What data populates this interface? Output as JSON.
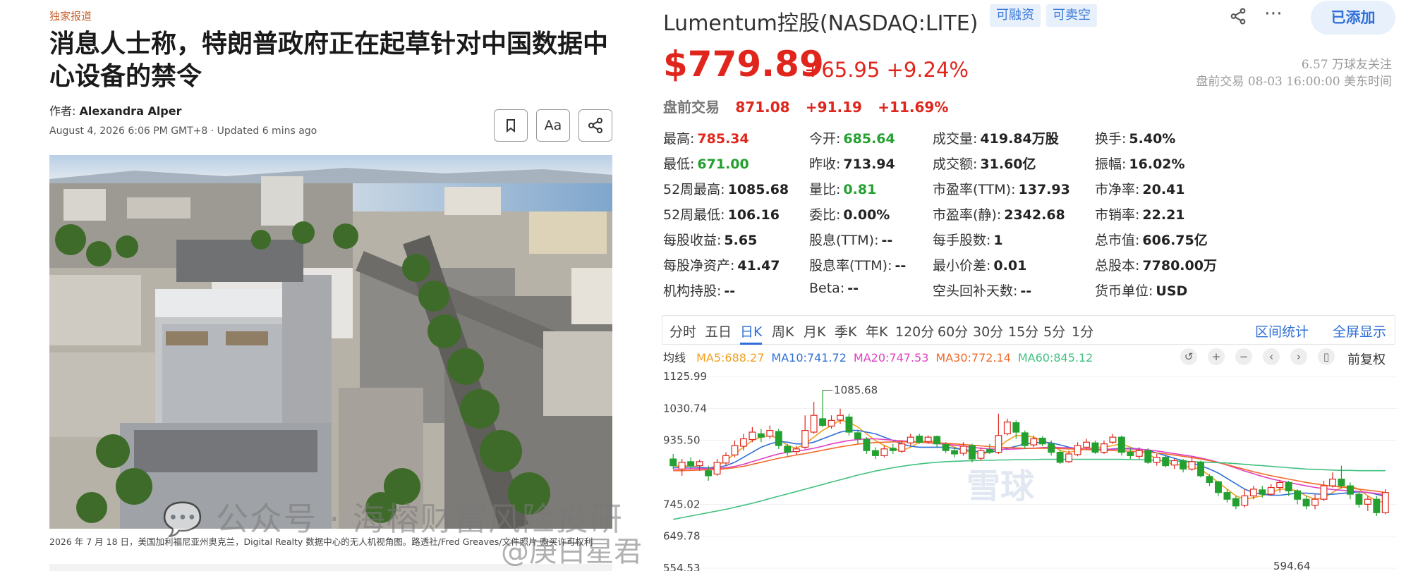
{
  "article": {
    "tag": "独家报道",
    "headline": "消息人士称，特朗普政府正在起草针对中国数据中心设备的禁令",
    "author_label": "作者:",
    "author_name": "Alexandra Alper",
    "dateline": "August 4, 2026 6:06 PM GMT+8 · Updated 6 mins ago",
    "bookmark_icon": "bookmark-icon",
    "font_size_label": "Aa",
    "share_icon": "share-icon",
    "photo_alt": "Digital Realty 数据中心的无人机视角图",
    "caption": "2026 年 7 月 18 日，美国加利福尼亚州奥克兰，Digital Realty 数据中心的无人机视角图。路透社/Fred Greaves/文件照片 购买许可权利"
  },
  "stock": {
    "title": "Lumentum控股(NASDAQ:LITE)",
    "pill_margin": "可融资",
    "pill_short": "可卖空",
    "share_icon": "share-icon",
    "more_icon": "more-icon",
    "follow_label": "已添加",
    "price": "$779.89",
    "change": "+65.95 +9.24%",
    "followers": "6.57 万球友关注",
    "status": "盘前交易 08-03 16:00:00 美东时间",
    "pre_label": "盘前交易",
    "pre_price": "871.08",
    "pre_change": "+91.19",
    "pre_pct": "+11.69%",
    "quote": [
      [
        {
          "k": "最高:",
          "v": "785.34",
          "c": "red"
        },
        {
          "k": "今开:",
          "v": "685.64",
          "c": "green"
        },
        {
          "k": "成交量:",
          "v": "419.84万股",
          "c": ""
        },
        {
          "k": "换手:",
          "v": "5.40%",
          "c": ""
        }
      ],
      [
        {
          "k": "最低:",
          "v": "671.00",
          "c": "green"
        },
        {
          "k": "昨收:",
          "v": "713.94",
          "c": ""
        },
        {
          "k": "成交额:",
          "v": "31.60亿",
          "c": ""
        },
        {
          "k": "振幅:",
          "v": "16.02%",
          "c": ""
        }
      ],
      [
        {
          "k": "52周最高:",
          "v": "1085.68",
          "c": ""
        },
        {
          "k": "量比:",
          "v": "0.81",
          "c": "green"
        },
        {
          "k": "市盈率(TTM):",
          "v": "137.93",
          "c": ""
        },
        {
          "k": "市净率:",
          "v": "20.41",
          "c": ""
        }
      ],
      [
        {
          "k": "52周最低:",
          "v": "106.16",
          "c": ""
        },
        {
          "k": "委比:",
          "v": "0.00%",
          "c": ""
        },
        {
          "k": "市盈率(静):",
          "v": "2342.68",
          "c": ""
        },
        {
          "k": "市销率:",
          "v": "22.21",
          "c": ""
        }
      ],
      [
        {
          "k": "每股收益:",
          "v": "5.65",
          "c": ""
        },
        {
          "k": "股息(TTM):",
          "v": "--",
          "c": ""
        },
        {
          "k": "每手股数:",
          "v": "1",
          "c": ""
        },
        {
          "k": "总市值:",
          "v": "606.75亿",
          "c": ""
        }
      ],
      [
        {
          "k": "每股净资产:",
          "v": "41.47",
          "c": ""
        },
        {
          "k": "股息率(TTM):",
          "v": "--",
          "c": ""
        },
        {
          "k": "最小价差:",
          "v": "0.01",
          "c": ""
        },
        {
          "k": "总股本:",
          "v": "7780.00万",
          "c": ""
        }
      ],
      [
        {
          "k": "机构持股:",
          "v": "--",
          "c": ""
        },
        {
          "k": "Beta:",
          "v": "--",
          "c": ""
        },
        {
          "k": "空头回补天数:",
          "v": "--",
          "c": ""
        },
        {
          "k": "货币单位:",
          "v": "USD",
          "c": ""
        }
      ]
    ],
    "tabs": [
      "分时",
      "五日",
      "日K",
      "周K",
      "月K",
      "季K",
      "年K",
      "120分",
      "60分",
      "30分",
      "15分",
      "5分",
      "1分"
    ],
    "active_tab": "日K",
    "tab_stats": "区间统计",
    "tab_full": "全屏显示",
    "ma_label": "均线",
    "ma": [
      {
        "label": "MA5:688.27",
        "color": "#f0a020"
      },
      {
        "label": "MA10:741.72",
        "color": "#2f6fd6"
      },
      {
        "label": "MA20:747.53",
        "color": "#e040c0"
      },
      {
        "label": "MA30:772.14",
        "color": "#f06a2a"
      },
      {
        "label": "MA60:845.12",
        "color": "#40c080"
      }
    ],
    "ctrl_icons": [
      "reset-icon",
      "zoom-in-icon",
      "zoom-out-icon",
      "prev-icon",
      "next-icon",
      "candle-toggle-icon"
    ],
    "adjust_label": "前复权"
  },
  "chart_data": {
    "type": "candlestick",
    "y_ticks": [
      "1125.99",
      "1030.74",
      "935.50",
      "745.02",
      "649.78",
      "554.53"
    ],
    "high_marker": "1085.68",
    "low_marker": "594.64",
    "ylim": [
      554.53,
      1125.99
    ],
    "up_color": "#e0261c",
    "down_color": "#23a030",
    "candles": [
      [
        880,
        860,
        895,
        850
      ],
      [
        850,
        870,
        880,
        830
      ],
      [
        872,
        860,
        885,
        852
      ],
      [
        860,
        872,
        878,
        845
      ],
      [
        845,
        830,
        860,
        815
      ],
      [
        835,
        870,
        880,
        830
      ],
      [
        868,
        890,
        900,
        860
      ],
      [
        892,
        920,
        935,
        885
      ],
      [
        918,
        940,
        955,
        905
      ],
      [
        938,
        960,
        975,
        930
      ],
      [
        955,
        945,
        970,
        930
      ],
      [
        948,
        965,
        980,
        940
      ],
      [
        962,
        920,
        970,
        910
      ],
      [
        918,
        900,
        925,
        890
      ],
      [
        902,
        910,
        918,
        892
      ],
      [
        915,
        965,
        1010,
        910
      ],
      [
        960,
        1010,
        1050,
        955
      ],
      [
        1000,
        980,
        1085,
        975
      ],
      [
        978,
        995,
        1010,
        970
      ],
      [
        996,
        1010,
        1030,
        985
      ],
      [
        1005,
        960,
        1015,
        950
      ],
      [
        958,
        940,
        965,
        925
      ],
      [
        938,
        905,
        945,
        895
      ],
      [
        905,
        890,
        915,
        880
      ],
      [
        890,
        910,
        920,
        885
      ],
      [
        912,
        905,
        925,
        895
      ],
      [
        903,
        925,
        935,
        898
      ],
      [
        928,
        945,
        955,
        920
      ],
      [
        948,
        930,
        955,
        925
      ],
      [
        932,
        945,
        950,
        925
      ],
      [
        947,
        925,
        950,
        915
      ],
      [
        923,
        905,
        930,
        898
      ],
      [
        905,
        895,
        915,
        885
      ],
      [
        897,
        918,
        930,
        890
      ],
      [
        920,
        880,
        925,
        870
      ],
      [
        882,
        905,
        915,
        875
      ],
      [
        908,
        900,
        925,
        895
      ],
      [
        900,
        950,
        1015,
        895
      ],
      [
        955,
        990,
        1000,
        950
      ],
      [
        988,
        960,
        995,
        940
      ],
      [
        958,
        920,
        965,
        910
      ],
      [
        922,
        940,
        950,
        915
      ],
      [
        942,
        925,
        948,
        918
      ],
      [
        925,
        900,
        935,
        890
      ],
      [
        900,
        870,
        908,
        865
      ],
      [
        872,
        895,
        905,
        868
      ],
      [
        893,
        920,
        930,
        888
      ],
      [
        915,
        930,
        940,
        910
      ],
      [
        928,
        900,
        935,
        895
      ],
      [
        900,
        925,
        935,
        895
      ],
      [
        930,
        945,
        955,
        925
      ],
      [
        945,
        900,
        950,
        890
      ],
      [
        900,
        890,
        910,
        880
      ],
      [
        888,
        905,
        915,
        880
      ],
      [
        905,
        870,
        912,
        865
      ],
      [
        870,
        885,
        895,
        860
      ],
      [
        885,
        860,
        892,
        855
      ],
      [
        862,
        875,
        880,
        850
      ],
      [
        875,
        850,
        880,
        840
      ],
      [
        850,
        872,
        885,
        845
      ],
      [
        870,
        830,
        875,
        825
      ],
      [
        828,
        810,
        835,
        800
      ],
      [
        812,
        780,
        815,
        770
      ],
      [
        780,
        760,
        790,
        750
      ],
      [
        762,
        740,
        770,
        730
      ],
      [
        742,
        770,
        790,
        735
      ],
      [
        770,
        790,
        800,
        760
      ],
      [
        788,
        775,
        800,
        765
      ],
      [
        775,
        795,
        805,
        770
      ],
      [
        795,
        810,
        818,
        780
      ],
      [
        810,
        785,
        815,
        770
      ],
      [
        785,
        760,
        790,
        745
      ],
      [
        760,
        740,
        770,
        730
      ],
      [
        742,
        760,
        775,
        730
      ],
      [
        760,
        800,
        815,
        755
      ],
      [
        800,
        820,
        840,
        795
      ],
      [
        820,
        800,
        860,
        792
      ],
      [
        800,
        775,
        810,
        760
      ],
      [
        775,
        745,
        785,
        735
      ],
      [
        745,
        760,
        770,
        725
      ],
      [
        760,
        720,
        770,
        710
      ],
      [
        720,
        780,
        790,
        715
      ]
    ],
    "ma": {
      "MA5": [
        860,
        858,
        860,
        855,
        852,
        860,
        875,
        895,
        915,
        935,
        945,
        950,
        940,
        920,
        912,
        925,
        945,
        965,
        980,
        995,
        990,
        975,
        955,
        935,
        920,
        910,
        905,
        915,
        930,
        935,
        930,
        925,
        915,
        905,
        900,
        895,
        900,
        915,
        935,
        950,
        950,
        945,
        935,
        925,
        905,
        900,
        905,
        910,
        915,
        915,
        920,
        925,
        915,
        905,
        895,
        880,
        870,
        865,
        860,
        855,
        850,
        830,
        810,
        790,
        770,
        760,
        765,
        770,
        780,
        790,
        790,
        785,
        770,
        760,
        765,
        780,
        795,
        800,
        790,
        770,
        755,
        750
      ],
      "MA10": [
        855,
        855,
        856,
        855,
        853,
        855,
        860,
        870,
        885,
        900,
        915,
        925,
        932,
        930,
        925,
        925,
        930,
        940,
        950,
        960,
        965,
        965,
        960,
        955,
        945,
        935,
        925,
        918,
        915,
        915,
        915,
        915,
        912,
        908,
        905,
        900,
        900,
        905,
        912,
        918,
        925,
        928,
        930,
        928,
        922,
        915,
        910,
        908,
        908,
        908,
        910,
        912,
        912,
        910,
        905,
        898,
        890,
        882,
        875,
        868,
        860,
        850,
        838,
        822,
        806,
        790,
        780,
        775,
        772,
        772,
        775,
        778,
        778,
        776,
        775,
        775,
        777,
        780,
        782,
        780,
        775,
        768
      ],
      "MA20": [
        850,
        850,
        851,
        851,
        851,
        852,
        854,
        858,
        864,
        872,
        880,
        888,
        895,
        900,
        903,
        907,
        912,
        918,
        925,
        930,
        935,
        938,
        940,
        940,
        938,
        936,
        934,
        932,
        930,
        928,
        926,
        924,
        921,
        918,
        915,
        912,
        910,
        909,
        909,
        910,
        911,
        912,
        914,
        915,
        914,
        913,
        911,
        910,
        909,
        909,
        909,
        910,
        910,
        909,
        907,
        904,
        900,
        896,
        892,
        888,
        883,
        877,
        870,
        862,
        853,
        844,
        836,
        828,
        821,
        815,
        810,
        805,
        800,
        795,
        792,
        789,
        787,
        785,
        783,
        780,
        777,
        773
      ],
      "MA30": [
        845,
        845,
        846,
        847,
        848,
        849,
        851,
        854,
        858,
        864,
        870,
        876,
        882,
        887,
        892,
        896,
        901,
        906,
        911,
        916,
        920,
        924,
        927,
        929,
        930,
        931,
        931,
        931,
        930,
        929,
        928,
        927,
        925,
        923,
        921,
        919,
        917,
        915,
        914,
        913,
        912,
        912,
        912,
        912,
        911,
        910,
        909,
        908,
        907,
        906,
        905,
        904,
        903,
        902,
        900,
        898,
        895,
        892,
        888,
        884,
        880,
        875,
        869,
        863,
        856,
        849,
        842,
        836,
        830,
        825,
        820,
        815,
        810,
        806,
        802,
        799,
        796,
        793,
        790,
        787,
        784,
        780
      ],
      "MA60": [
        700,
        705,
        710,
        715,
        720,
        725,
        730,
        736,
        742,
        748,
        755,
        762,
        769,
        776,
        783,
        790,
        797,
        804,
        811,
        818,
        825,
        832,
        838,
        844,
        849,
        854,
        858,
        862,
        865,
        868,
        870,
        872,
        873,
        874,
        875,
        876,
        876,
        877,
        877,
        878,
        878,
        878,
        879,
        879,
        879,
        879,
        879,
        879,
        879,
        879,
        879,
        879,
        878,
        878,
        877,
        876,
        875,
        874,
        873,
        872,
        871,
        870,
        869,
        868,
        866,
        864,
        862,
        860,
        858,
        856,
        854,
        852,
        850,
        849,
        848,
        847,
        846,
        846,
        845,
        845,
        845,
        845
      ]
    }
  },
  "watermarks": {
    "wechat": "公众号 · 海榕财富风险投研",
    "xueqiu": "雪球",
    "weibo": "@庚白星君"
  }
}
